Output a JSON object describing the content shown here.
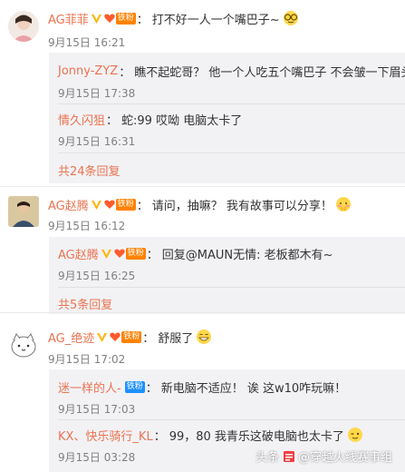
{
  "comments": [
    {
      "user": "AG菲菲",
      "fan_tag": "铁粉",
      "text": "打不好一人一个嘴巴子~",
      "date": "9月15日 16:21",
      "replies": [
        {
          "user": "Jonny-ZYZ",
          "text": "瞧不起蛇哥？ 他一个人吃五个嘴巴子 不会皱一下眉头",
          "date": "9月15日 17:38"
        },
        {
          "user": "情久闪狙",
          "text": "蛇:99  哎呦  电脑太卡了",
          "date": "9月15日 16:31"
        }
      ],
      "more": "共24条回复"
    },
    {
      "user": "AG赵腾",
      "fan_tag": "铁粉",
      "text": "请问，抽嘛？ 我有故事可以分享！",
      "date": "9月15日 16:12",
      "replies": [
        {
          "user": "AG赵腾",
          "fan_tag": "铁粉",
          "text": "回复@MAUN无情: 老板都木有~",
          "date": "9月15日 16:25"
        }
      ],
      "more": "共5条回复"
    },
    {
      "user": "AG_绝迹",
      "fan_tag": "铁粉",
      "text": "舒服了",
      "date": "9月15日 17:02",
      "replies": [
        {
          "user": "迷一样的人-",
          "fan_tag": "铁粉",
          "text": "新电脑不适应！ 诶 这w10咋玩嘛！",
          "date": "9月15日 17:03"
        },
        {
          "user": "KX、快乐骑行_KL",
          "text": "99，80 我青乐这破电脑也太卡了",
          "date": "9月15日 03:28"
        }
      ]
    }
  ],
  "watermark": {
    "left": "头条",
    "right": "@穿越火线赛事组"
  },
  "colors": {
    "accent": "#eb7350",
    "fan": "#ff8200",
    "reply_bg": "#f2f2f5"
  }
}
